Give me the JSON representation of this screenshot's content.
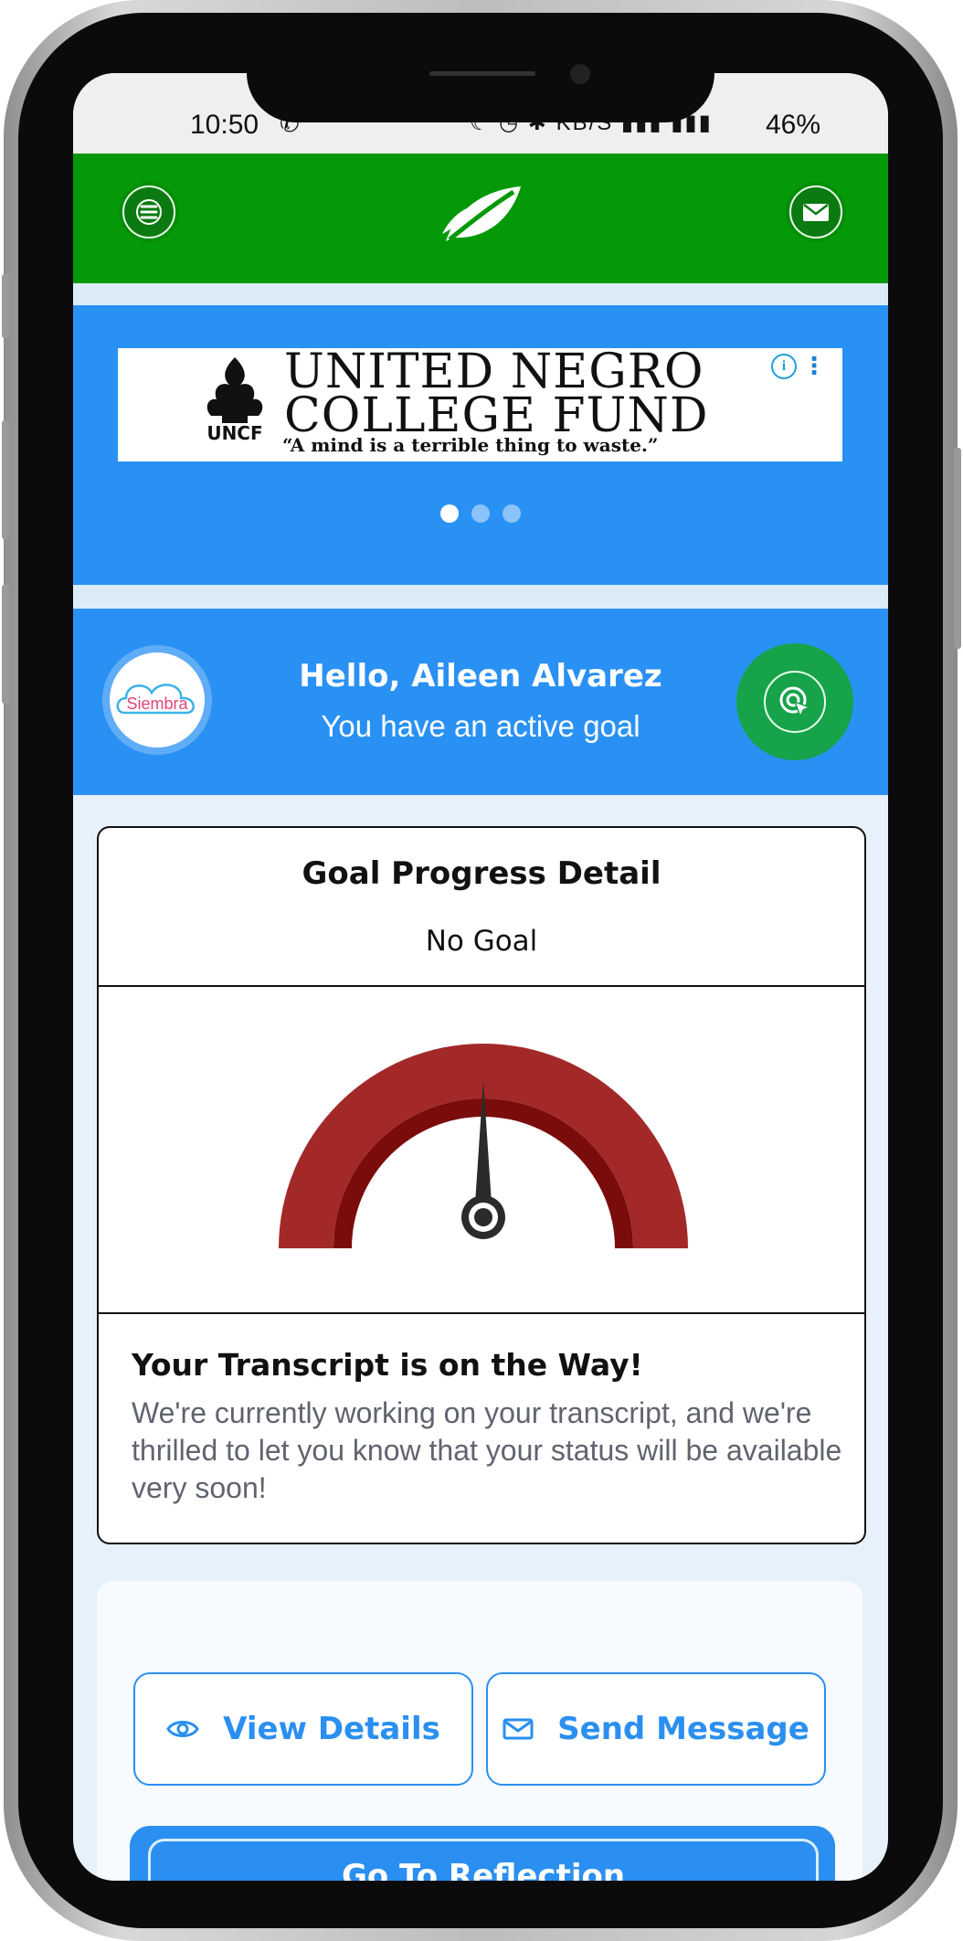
{
  "status_bar": {
    "time": "10:50",
    "whatsapp_glyph": "✆",
    "icons_text": "☾ ◷ ✱ KB/S ▮▮▮ ▮▮▮",
    "battery": "46%"
  },
  "app_bar": {
    "menu_icon": "hamburger-menu-icon",
    "logo_icon": "leaf-logo-icon",
    "mail_icon": "mail-icon",
    "color": "#05990a"
  },
  "ad_banner": {
    "title_line1": "UNITED NEGRO",
    "title_line2": "COLLEGE FUND",
    "tagline": "“A mind is a terrible thing to waste.”",
    "logo_text": "UNCF",
    "info_glyph": "i",
    "more_glyph": "⋮",
    "slides": 3,
    "active_slide": 0
  },
  "welcome": {
    "avatar_text": "Siembra",
    "greeting": "Hello, Aileen Alvarez",
    "subtitle": "You have an active goal"
  },
  "goal_card": {
    "title": "Goal Progress Detail",
    "goal": "No Goal",
    "gauge_value": 0.5,
    "gauge_colors": {
      "outer": "#a32929",
      "inner": "#7a0c0c"
    },
    "transcript_title": "Your Transcript is on the Way!",
    "transcript_body": "We're currently working on your transcript, and we're thrilled to let you know that your status will be available very soon!"
  },
  "actions": {
    "view_details": "View Details",
    "send_message": "Send Message",
    "reflection": "Go To Reflection"
  },
  "colors": {
    "primary_blue": "#2a91f4",
    "accent_green": "#16a34a"
  }
}
